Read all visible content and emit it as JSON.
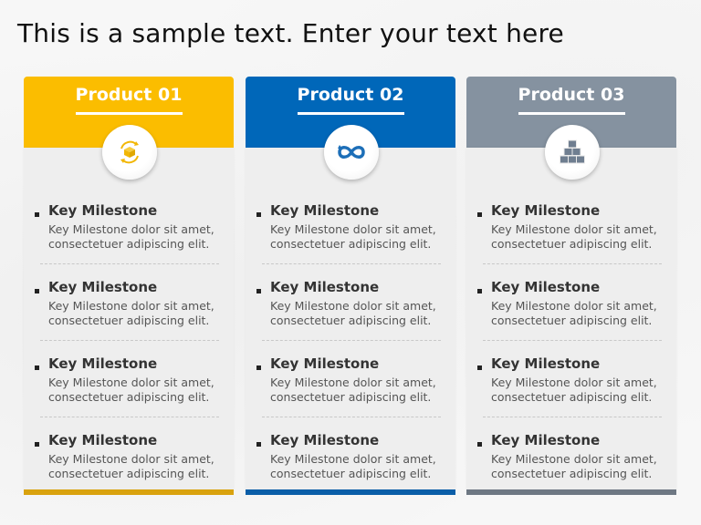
{
  "slide": {
    "title": "This is a sample text. Enter your text here"
  },
  "cards": [
    {
      "name": "Product 01",
      "color": "#fbbd00",
      "bar_color": "#d9a20e",
      "icon": "refresh-box-icon",
      "icon_color": "#f2b705",
      "items": [
        {
          "heading": "Key Milestone",
          "desc_line1": "Key Milestone dolor sit amet,",
          "desc_line2": "consectetuer adipiscing elit."
        },
        {
          "heading": "Key Milestone",
          "desc_line1": "Key Milestone dolor sit amet,",
          "desc_line2": "consectetuer adipiscing elit."
        },
        {
          "heading": "Key Milestone",
          "desc_line1": "Key Milestone dolor sit amet,",
          "desc_line2": "consectetuer adipiscing elit."
        },
        {
          "heading": "Key Milestone",
          "desc_line1": "Key Milestone dolor sit amet,",
          "desc_line2": "consectetuer adipiscing elit."
        }
      ]
    },
    {
      "name": "Product 02",
      "color": "#0067b9",
      "bar_color": "#0a5ea8",
      "icon": "infinity-icon",
      "icon_color": "#1d6fb8",
      "items": [
        {
          "heading": "Key Milestone",
          "desc_line1": "Key Milestone dolor sit amet,",
          "desc_line2": "consectetuer adipiscing elit."
        },
        {
          "heading": "Key Milestone",
          "desc_line1": "Key Milestone dolor sit amet,",
          "desc_line2": "consectetuer adipiscing elit."
        },
        {
          "heading": "Key Milestone",
          "desc_line1": "Key Milestone dolor sit amet,",
          "desc_line2": "consectetuer adipiscing elit."
        },
        {
          "heading": "Key Milestone",
          "desc_line1": "Key Milestone dolor sit amet,",
          "desc_line2": "consectetuer adipiscing elit."
        }
      ]
    },
    {
      "name": "Product 03",
      "color": "#8592a0",
      "bar_color": "#6e7883",
      "icon": "stacked-boxes-icon",
      "icon_color": "#6f7e90",
      "items": [
        {
          "heading": "Key Milestone",
          "desc_line1": "Key Milestone dolor sit amet,",
          "desc_line2": "consectetuer adipiscing elit."
        },
        {
          "heading": "Key Milestone",
          "desc_line1": "Key Milestone dolor sit amet,",
          "desc_line2": "consectetuer adipiscing elit."
        },
        {
          "heading": "Key Milestone",
          "desc_line1": "Key Milestone dolor sit amet,",
          "desc_line2": "consectetuer adipiscing elit."
        },
        {
          "heading": "Key Milestone",
          "desc_line1": "Key Milestone dolor sit amet,",
          "desc_line2": "consectetuer adipiscing elit."
        }
      ]
    }
  ]
}
